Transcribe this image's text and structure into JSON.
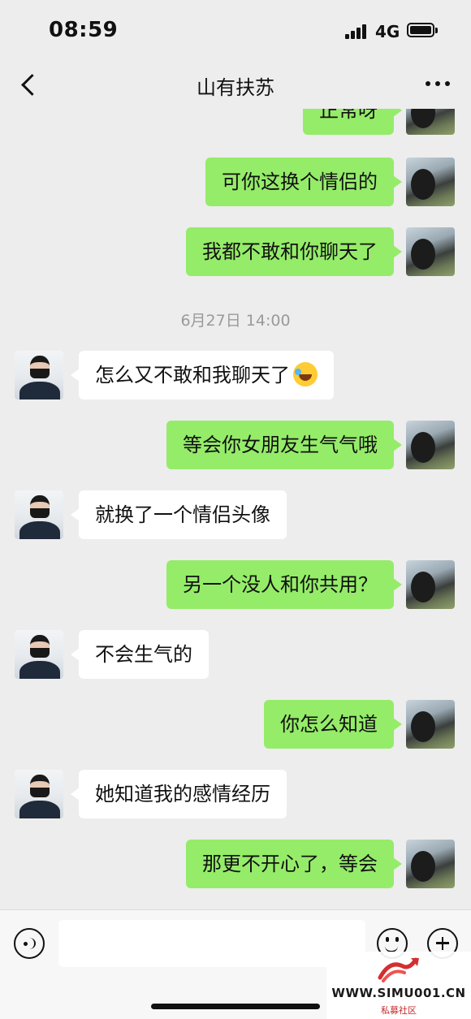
{
  "status": {
    "time": "08:59",
    "network": "4G"
  },
  "nav": {
    "title": "山有扶苏"
  },
  "messages": [
    {
      "side": "out",
      "text": "正常呀"
    },
    {
      "side": "out",
      "text": "可你这换个情侣的"
    },
    {
      "side": "out",
      "text": "我都不敢和你聊天了"
    },
    {
      "timestamp": "6月27日 14:00"
    },
    {
      "side": "in",
      "text": "怎么又不敢和我聊天了",
      "emoji": "crying-laugh-emoji"
    },
    {
      "side": "out",
      "text": "等会你女朋友生气气哦"
    },
    {
      "side": "in",
      "text": "就换了一个情侣头像"
    },
    {
      "side": "out",
      "text": "另一个没人和你共用？"
    },
    {
      "side": "in",
      "text": "不会生气的"
    },
    {
      "side": "out",
      "text": "你怎么知道"
    },
    {
      "side": "in",
      "text": "她知道我的感情经历"
    },
    {
      "side": "out",
      "text": "那更不开心了，等会"
    }
  ],
  "input": {
    "value": "",
    "placeholder": ""
  },
  "colors": {
    "outgoing_bubble": "#95ec69",
    "incoming_bubble": "#ffffff",
    "background": "#ededed"
  },
  "watermark": {
    "url": "WWW.SIMU001.CN",
    "subtitle": "私募社区"
  }
}
